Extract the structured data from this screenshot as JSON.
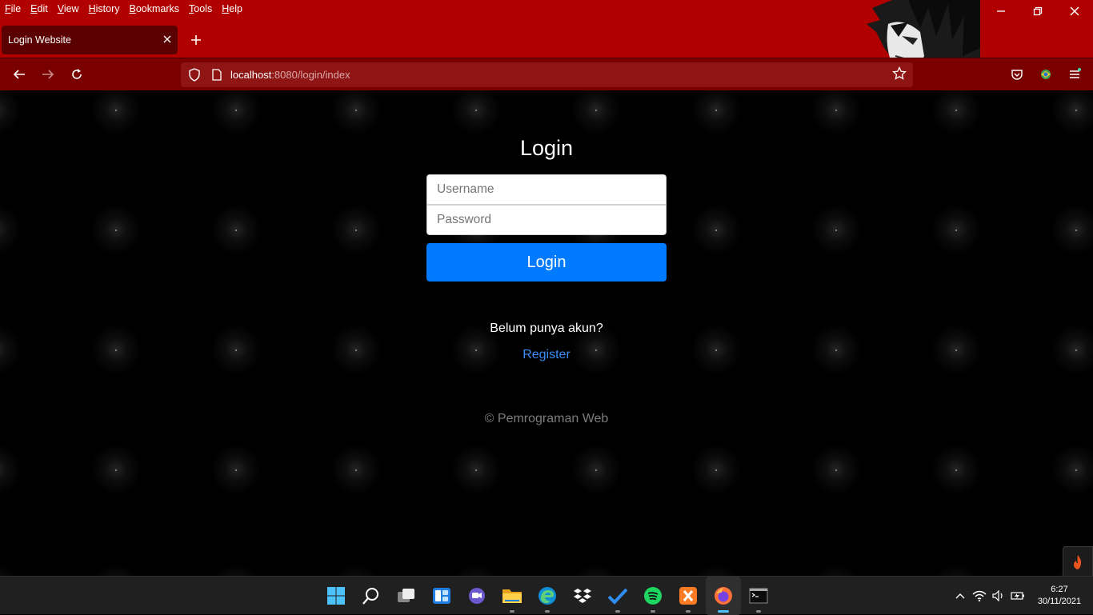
{
  "browser": {
    "menu": [
      "File",
      "Edit",
      "View",
      "History",
      "Bookmarks",
      "Tools",
      "Help"
    ],
    "tab_title": "Login Website",
    "url_host": "localhost",
    "url_path": ":8080/login/index"
  },
  "page": {
    "title": "Login",
    "username_placeholder": "Username",
    "password_placeholder": "Password",
    "login_button": "Login",
    "no_account_text": "Belum punya akun?",
    "register_link": "Register",
    "copyright": "© Pemrograman Web"
  },
  "taskbar": {
    "apps": [
      "start-icon",
      "search-icon",
      "task-view-icon",
      "widgets-icon",
      "teams-chat-icon",
      "file-explorer-icon",
      "edge-icon",
      "dropbox-icon",
      "todo-icon",
      "spotify-icon",
      "xampp-icon",
      "firefox-icon",
      "terminal-icon"
    ],
    "time": "6:27",
    "date": "30/11/2021"
  },
  "colors": {
    "chrome_red": "#b00000",
    "login_button": "#007bff",
    "link": "#3b8df5"
  }
}
